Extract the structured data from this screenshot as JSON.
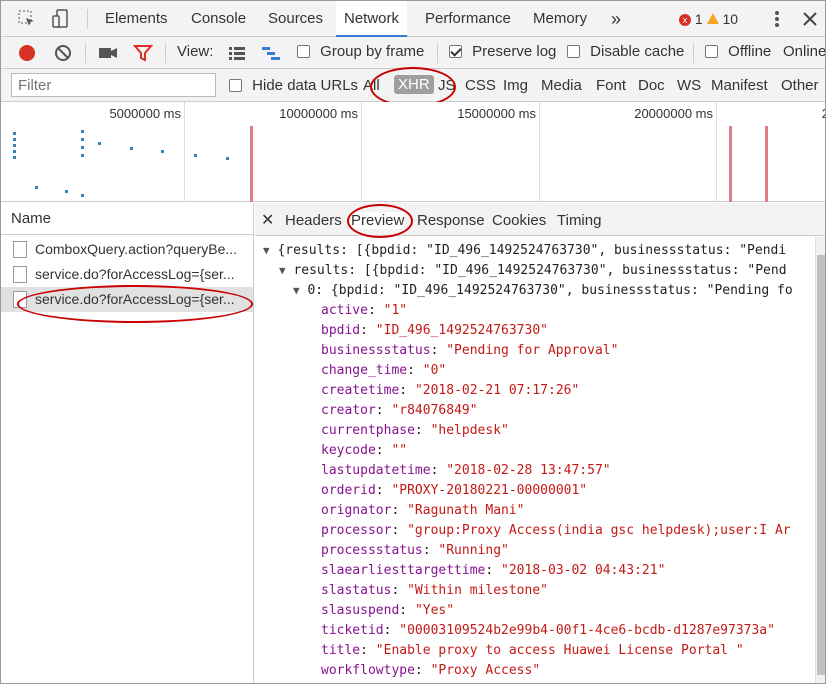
{
  "tabs": [
    "Elements",
    "Console",
    "Sources",
    "Network",
    "Performance",
    "Memory"
  ],
  "more_tabs": "»",
  "errors": "1",
  "warnings": "10",
  "toolbar": {
    "view_label": "View:",
    "group_by_frame": "Group by frame",
    "preserve_log": "Preserve log",
    "disable_cache": "Disable cache",
    "offline": "Offline",
    "online": "Online"
  },
  "filter": {
    "placeholder": "Filter",
    "hide_data_urls": "Hide data URLs",
    "types": [
      "All",
      "XHR",
      "JS",
      "CSS",
      "Img",
      "Media",
      "Font",
      "Doc",
      "WS",
      "Manifest",
      "Other"
    ]
  },
  "overview": {
    "ticks": [
      "5000000 ms",
      "10000000 ms",
      "15000000 ms",
      "20000000 ms",
      "2"
    ]
  },
  "requests": {
    "header": "Name",
    "items": [
      "ComboxQuery.action?queryBe...",
      "service.do?forAccessLog={ser...",
      "service.do?forAccessLog={ser..."
    ]
  },
  "detail_tabs": [
    "Headers",
    "Preview",
    "Response",
    "Cookies",
    "Timing"
  ],
  "preview": {
    "root": "{results: [{bpdid: \"ID_496_1492524763730\", businessstatus: \"Pendi",
    "results_line": "results: [{bpdid: \"ID_496_1492524763730\", businessstatus: \"Pend",
    "item0": "0: {bpdid: \"ID_496_1492524763730\", businessstatus: \"Pending fo",
    "fields": [
      {
        "k": "active",
        "v": "\"1\""
      },
      {
        "k": "bpdid",
        "v": "\"ID_496_1492524763730\""
      },
      {
        "k": "businessstatus",
        "v": "\"Pending for Approval\""
      },
      {
        "k": "change_time",
        "v": "\"0\""
      },
      {
        "k": "createtime",
        "v": "\"2018-02-21 07:17:26\""
      },
      {
        "k": "creator",
        "v": "\"r84076849\""
      },
      {
        "k": "currentphase",
        "v": "\"helpdesk\""
      },
      {
        "k": "keycode",
        "v": "\"\""
      },
      {
        "k": "lastupdatetime",
        "v": "\"2018-02-28 13:47:57\""
      },
      {
        "k": "orderid",
        "v": "\"PROXY-20180221-00000001\""
      },
      {
        "k": "orignator",
        "v": "\"Ragunath Mani\""
      },
      {
        "k": "processor",
        "v": "\"group:Proxy Access(india gsc helpdesk);user:I Ar"
      },
      {
        "k": "processstatus",
        "v": "\"Running\""
      },
      {
        "k": "slaearliesttargettime",
        "v": "\"2018-03-02 04:43:21\""
      },
      {
        "k": "slastatus",
        "v": "\"Within milestone\""
      },
      {
        "k": "slasuspend",
        "v": "\"Yes\""
      },
      {
        "k": "ticketid",
        "v": "\"00003109524b2e99b4-00f1-4ce6-bcdb-d1287e97373a\""
      },
      {
        "k": "title",
        "v": "\"Enable proxy to access Huawei License Portal \""
      },
      {
        "k": "workflowtype",
        "v": "\"Proxy Access\""
      }
    ]
  },
  "colors": {
    "accent": "#3879d9",
    "record": "#d93025",
    "highlight_ring": "#c80000"
  }
}
